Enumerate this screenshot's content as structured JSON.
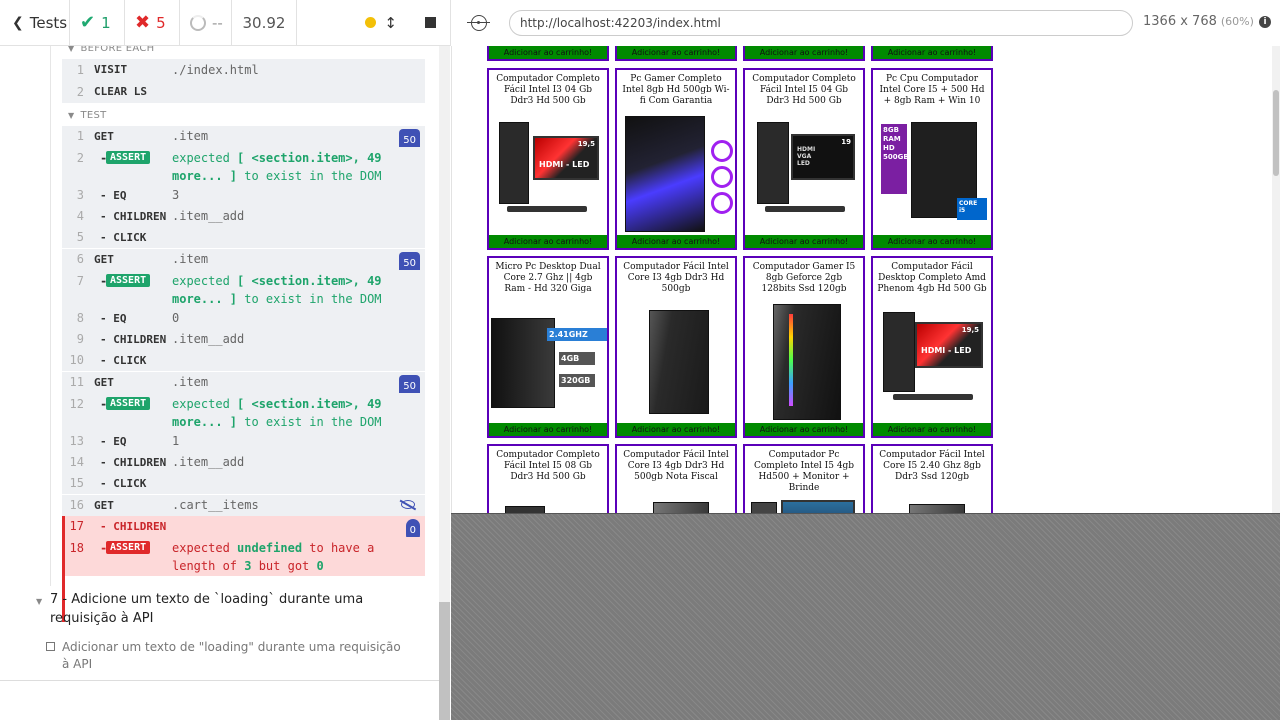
{
  "reporter": {
    "header": {
      "tests_label": "Tests",
      "passed": "1",
      "failed": "5",
      "pending": "--",
      "duration": "30.92"
    },
    "before_each_label": "BEFORE EACH",
    "test_label": "TEST",
    "before_each": [
      {
        "num": "1",
        "name": "VISIT",
        "msg": "./index.html"
      },
      {
        "num": "2",
        "name": "CLEAR LS",
        "msg": ""
      }
    ],
    "commands": [
      {
        "num": "1",
        "name": "GET",
        "msg": ".item",
        "badge": "50"
      },
      {
        "num": "2",
        "name": "ASSERT",
        "msg_a": "expected ",
        "msg_b": "[ <section.item>, 49",
        "msg_c": "more... ]",
        "msg_d": " to exist in the DOM"
      },
      {
        "num": "3",
        "name": "EQ",
        "msg": "3"
      },
      {
        "num": "4",
        "name": "CHILDREN",
        "msg": ".item__add"
      },
      {
        "num": "5",
        "name": "CLICK",
        "msg": ""
      },
      {
        "num": "6",
        "name": "GET",
        "msg": ".item",
        "badge": "50"
      },
      {
        "num": "7",
        "name": "ASSERT",
        "msg_a": "expected ",
        "msg_b": "[ <section.item>, 49",
        "msg_c": "more... ]",
        "msg_d": " to exist in the DOM"
      },
      {
        "num": "8",
        "name": "EQ",
        "msg": "0"
      },
      {
        "num": "9",
        "name": "CHILDREN",
        "msg": ".item__add"
      },
      {
        "num": "10",
        "name": "CLICK",
        "msg": ""
      },
      {
        "num": "11",
        "name": "GET",
        "msg": ".item",
        "badge": "50"
      },
      {
        "num": "12",
        "name": "ASSERT",
        "msg_a": "expected ",
        "msg_b": "[ <section.item>, 49",
        "msg_c": "more... ]",
        "msg_d": " to exist in the DOM"
      },
      {
        "num": "13",
        "name": "EQ",
        "msg": "1"
      },
      {
        "num": "14",
        "name": "CHILDREN",
        "msg": ".item__add"
      },
      {
        "num": "15",
        "name": "CLICK",
        "msg": ""
      },
      {
        "num": "16",
        "name": "GET",
        "msg": ".cart__items"
      },
      {
        "num": "17",
        "name": "CHILDREN",
        "msg": "",
        "badge": "0"
      },
      {
        "num": "18",
        "name": "ASSERT",
        "msg_a": "expected ",
        "msg_b": "undefined",
        "msg_c": " to have a",
        "msg_d": "length of ",
        "msg_e": "3",
        "msg_f": " but got ",
        "msg_g": "0"
      }
    ],
    "test7_title": "7 - Adicione um texto de `loading` durante uma requisição à API",
    "test7_sub": "Adicionar um texto de \"loading\" durante uma requisição à API"
  },
  "runner": {
    "url": "http://localhost:42203/index.html",
    "viewport": "1366 x 768",
    "scale": "(60%)",
    "info": "i"
  },
  "products": {
    "button_label": "Adicionar ao carrinho!",
    "items": [
      {
        "title": "Computador Completo Fácil Intel I3 04 Gb Ddr3 Hd 500 Gb"
      },
      {
        "title": "Pc Gamer Completo Intel 8gb Hd 500gb Wi-fi Com Garantia"
      },
      {
        "title": "Computador Completo Fácil Intel I5 04 Gb Ddr3 Hd 500 Gb"
      },
      {
        "title": "Pc Cpu Computador Intel Core I5 + 500 Hd + 8gb Ram + Win 10"
      },
      {
        "title": "Micro Pc Desktop Dual Core 2.7 Ghz || 4gb Ram - Hd 320 Giga"
      },
      {
        "title": "Computador Fácil Intel Core I3 4gb Ddr3 Hd 500gb"
      },
      {
        "title": "Computador Gamer I5 8gb Geforce 2gb 128bits Ssd 120gb"
      },
      {
        "title": "Computador Fácil Desktop Completo Amd Phenom 4gb Hd 500 Gb"
      },
      {
        "title": "Computador Completo Fácil Intel I5 08 Gb Ddr3 Hd 500 Gb"
      },
      {
        "title": "Computador Fácil Intel Core I3 4gb Ddr3 Hd 500gb Nota Fiscal"
      },
      {
        "title": "Computador Pc Completo Intel I5 4gb Hd500 + Monitor + Brinde"
      },
      {
        "title": "Computador Fácil Intel Core I5 2.40 Ghz 8gb Ddr3 Ssd 120gb"
      }
    ],
    "image_texts": {
      "monitor_size": "19,5",
      "hdmi_led": "HDMI - LED",
      "monitor2_size": "19",
      "monitor2_text": "HDMI VGA LED",
      "ram_tag": "8GB RAM HD 500GB",
      "cpu_badge": "CORE i5",
      "ghz_tag": "2.41GHZ",
      "mem_tag": "4GB",
      "hd_tag": "320GB"
    }
  }
}
